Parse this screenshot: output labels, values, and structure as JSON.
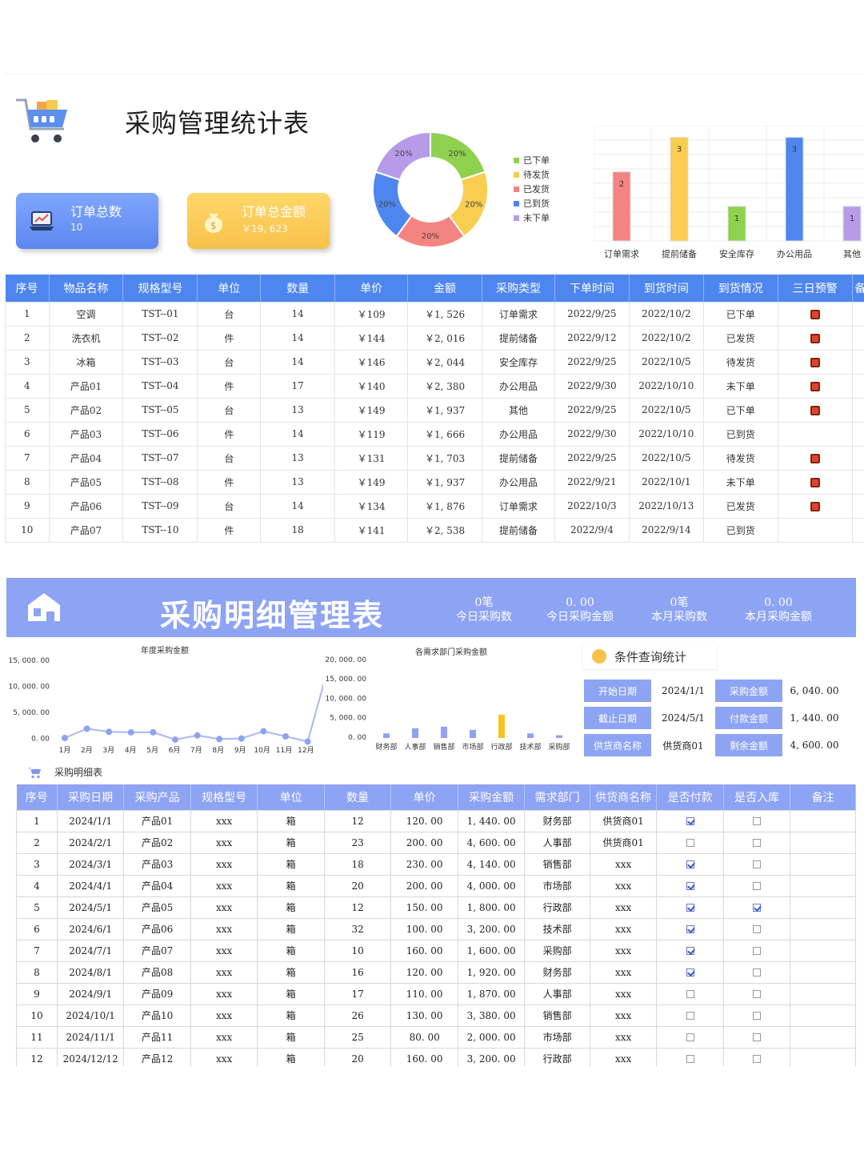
{
  "dashboard": {
    "title": "采购管理统计表",
    "cards": [
      {
        "label": "订单总数",
        "value": "10"
      },
      {
        "label": "订单总金额",
        "value": "￥19, 623"
      }
    ],
    "donut_labels": [
      "20%",
      "20%",
      "20%",
      "20%",
      "20%"
    ],
    "legend": [
      "已下单",
      "待发货",
      "已发货",
      "已到货",
      "未下单"
    ],
    "colors": {
      "blue": "#4e86f0",
      "green": "#8ed14e",
      "yellow": "#f9cd4f",
      "red": "#f48482",
      "purple": "#b79be8",
      "alert": "#d9452e"
    }
  },
  "chart_data": [
    {
      "type": "pie",
      "labels": [
        "已下单",
        "待发货",
        "已发货",
        "已到货",
        "未下单"
      ],
      "values": [
        20,
        20,
        20,
        20,
        20
      ]
    },
    {
      "type": "bar",
      "categories": [
        "订单需求",
        "提前储备",
        "安全库存",
        "办公用品",
        "其他"
      ],
      "values": [
        2,
        3,
        1,
        3,
        1
      ]
    },
    {
      "type": "line",
      "title": "年度采购金额",
      "categories": [
        "1月",
        "2月",
        "3月",
        "4月",
        "5月",
        "6月",
        "7月",
        "8月",
        "9月",
        "10月",
        "11月",
        "12月"
      ],
      "values": [
        0,
        1800,
        1200,
        1100,
        1100,
        -300,
        500,
        -200,
        -100,
        1300,
        300,
        -700,
        14700
      ],
      "yticks": [
        "15, 000. 00",
        "10, 000. 00",
        "5, 000. 00",
        "0. 00"
      ],
      "ylim": [
        -1000,
        15000
      ]
    },
    {
      "type": "bar",
      "title": "各需求部门采购金额",
      "categories": [
        "财务部",
        "人事部",
        "销售部",
        "市场部",
        "行政部",
        "技术部",
        "采购部"
      ],
      "values": [
        1200,
        2500,
        2900,
        2100,
        6000,
        1200,
        700
      ],
      "yticks": [
        "20, 000. 00",
        "15, 000. 00",
        "10, 000. 00",
        "5, 000. 00",
        "0. 00"
      ],
      "ylim": [
        0,
        20000
      ]
    }
  ],
  "table1": {
    "headers": [
      "序号",
      "物品名称",
      "规格型号",
      "单位",
      "数量",
      "单价",
      "金额",
      "采购类型",
      "下单时间",
      "到货时间",
      "到货情况",
      "三日预警",
      "备"
    ],
    "rows": [
      [
        "1",
        "空调",
        "TST--01",
        "台",
        "14",
        "￥109",
        "￥1, 526",
        "订单需求",
        "2022/9/25",
        "2022/10/2",
        "已下单",
        "alert"
      ],
      [
        "2",
        "洗衣机",
        "TST--02",
        "件",
        "14",
        "￥144",
        "￥2, 016",
        "提前储备",
        "2022/9/12",
        "2022/10/2",
        "已发货",
        "alert"
      ],
      [
        "3",
        "冰箱",
        "TST--03",
        "台",
        "14",
        "￥146",
        "￥2, 044",
        "安全库存",
        "2022/9/25",
        "2022/10/5",
        "待发货",
        "alert"
      ],
      [
        "4",
        "产品01",
        "TST--04",
        "件",
        "17",
        "￥140",
        "￥2, 380",
        "办公用品",
        "2022/9/30",
        "2022/10/10",
        "未下单",
        "alert"
      ],
      [
        "5",
        "产品02",
        "TST--05",
        "台",
        "13",
        "￥149",
        "￥1, 937",
        "其他",
        "2022/9/25",
        "2022/10/5",
        "已下单",
        "alert"
      ],
      [
        "6",
        "产品03",
        "TST--06",
        "件",
        "14",
        "￥119",
        "￥1, 666",
        "办公用品",
        "2022/9/30",
        "2022/10/10",
        "已到货",
        ""
      ],
      [
        "7",
        "产品04",
        "TST--07",
        "台",
        "13",
        "￥131",
        "￥1, 703",
        "提前储备",
        "2022/9/25",
        "2022/10/5",
        "待发货",
        "alert"
      ],
      [
        "8",
        "产品05",
        "TST--08",
        "件",
        "13",
        "￥149",
        "￥1, 937",
        "办公用品",
        "2022/9/21",
        "2022/10/1",
        "未下单",
        "alert"
      ],
      [
        "9",
        "产品06",
        "TST--09",
        "台",
        "14",
        "￥134",
        "￥1, 876",
        "订单需求",
        "2022/10/3",
        "2022/10/13",
        "已发货",
        "alert"
      ],
      [
        "10",
        "产品07",
        "TST--10",
        "件",
        "18",
        "￥141",
        "￥2, 538",
        "提前储备",
        "2022/9/4",
        "2022/9/14",
        "已到货",
        ""
      ]
    ]
  },
  "detail": {
    "banner_title": "采购明细管理表",
    "kpis": [
      {
        "value": "0笔",
        "label": "今日采购数"
      },
      {
        "value": "0. 00",
        "label": "今日采购金额"
      },
      {
        "value": "0笔",
        "label": "本月采购数"
      },
      {
        "value": "0. 00",
        "label": "本月采购金额"
      }
    ],
    "query_title": "条件查询统计",
    "query": [
      {
        "label": "开始日期",
        "value": "2024/1/1",
        "label2": "采购金额",
        "value2": "6, 040. 00"
      },
      {
        "label": "截止日期",
        "value": "2024/5/1",
        "label2": "付款金额",
        "value2": "1, 440. 00"
      },
      {
        "label": "供货商名称",
        "value": "供货商01",
        "label2": "剩余金额",
        "value2": "4, 600. 00"
      }
    ],
    "sub_title": "采购明细表"
  },
  "table2": {
    "headers": [
      "序号",
      "采购日期",
      "采购产品",
      "规格型号",
      "单位",
      "数量",
      "单价",
      "采购金额",
      "需求部门",
      "供货商名称",
      "是否付款",
      "是否入库",
      "备注"
    ],
    "rows": [
      [
        "1",
        "2024/1/1",
        "产品01",
        "xxx",
        "箱",
        "12",
        "120. 00",
        "1, 440. 00",
        "财务部",
        "供货商01",
        true,
        false
      ],
      [
        "2",
        "2024/2/1",
        "产品02",
        "xxx",
        "箱",
        "23",
        "200. 00",
        "4, 600. 00",
        "人事部",
        "供货商01",
        false,
        false
      ],
      [
        "3",
        "2024/3/1",
        "产品03",
        "xxx",
        "箱",
        "18",
        "230. 00",
        "4, 140. 00",
        "销售部",
        "xxx",
        true,
        false
      ],
      [
        "4",
        "2024/4/1",
        "产品04",
        "xxx",
        "箱",
        "20",
        "200. 00",
        "4, 000. 00",
        "市场部",
        "xxx",
        true,
        false
      ],
      [
        "5",
        "2024/5/1",
        "产品05",
        "xxx",
        "箱",
        "12",
        "150. 00",
        "1, 800. 00",
        "行政部",
        "xxx",
        true,
        true
      ],
      [
        "6",
        "2024/6/1",
        "产品06",
        "xxx",
        "箱",
        "32",
        "100. 00",
        "3, 200. 00",
        "技术部",
        "xxx",
        true,
        false
      ],
      [
        "7",
        "2024/7/1",
        "产品07",
        "xxx",
        "箱",
        "10",
        "160. 00",
        "1, 600. 00",
        "采购部",
        "xxx",
        true,
        false
      ],
      [
        "8",
        "2024/8/1",
        "产品08",
        "xxx",
        "箱",
        "16",
        "120. 00",
        "1, 920. 00",
        "财务部",
        "xxx",
        true,
        false
      ],
      [
        "9",
        "2024/9/1",
        "产品09",
        "xxx",
        "箱",
        "17",
        "110. 00",
        "1, 870. 00",
        "人事部",
        "xxx",
        false,
        false
      ],
      [
        "10",
        "2024/10/1",
        "产品10",
        "xxx",
        "箱",
        "26",
        "130. 00",
        "3, 380. 00",
        "销售部",
        "xxx",
        false,
        false
      ],
      [
        "11",
        "2024/11/1",
        "产品11",
        "xxx",
        "箱",
        "25",
        "80. 00",
        "2, 000. 00",
        "市场部",
        "xxx",
        false,
        false
      ],
      [
        "12",
        "2024/12/12",
        "产品12",
        "xxx",
        "箱",
        "20",
        "160. 00",
        "3, 200. 00",
        "行政部",
        "xxx",
        false,
        false
      ]
    ]
  }
}
